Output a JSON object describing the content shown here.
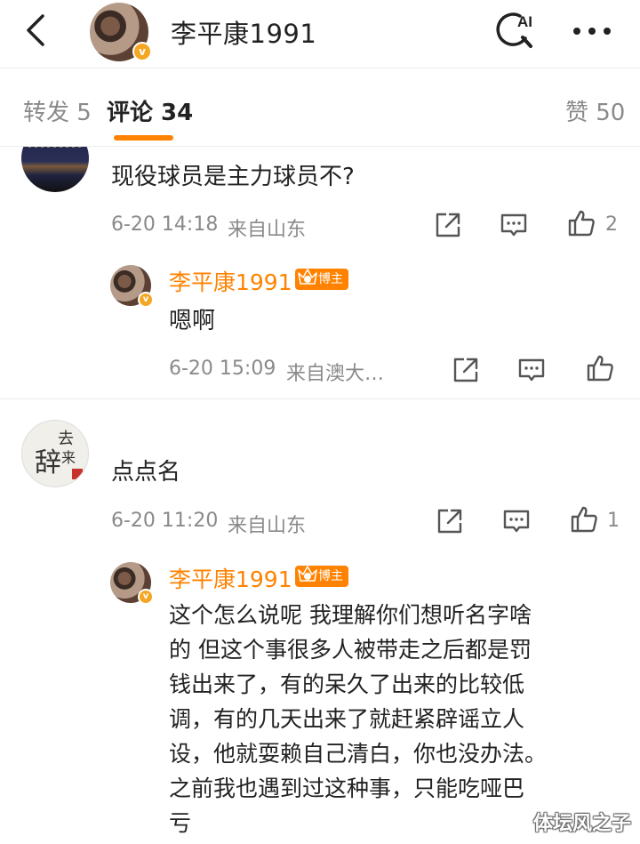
{
  "header": {
    "user_name": "李平康1991",
    "verified_badge": "v",
    "ai_label": "AI",
    "icons": [
      "back-arrow-icon",
      "ai-search-icon",
      "more-dots-icon"
    ]
  },
  "tabs": {
    "repost": "转发 5",
    "comments": "评论 34",
    "likes": "赞 50",
    "accent_color": "#ff8200"
  },
  "comments": [
    {
      "text": "现役球员是主力球员不?",
      "time": "6-20 14:18",
      "location": "来自山东",
      "like_count": "2",
      "reply": {
        "name": "李平康1991",
        "badge": "博主",
        "text": "嗯啊",
        "time": "6-20 15:09",
        "location": "来自澳大…"
      }
    },
    {
      "avatar_text": [
        "去",
        "来",
        "辞"
      ],
      "text": "点点名",
      "time": "6-20 11:20",
      "location": "来自山东",
      "like_count": "1",
      "reply": {
        "name": "李平康1991",
        "badge": "博主",
        "lines": [
          "这个怎么说呢 我理解你们想听名字啥",
          "的 但这个事很多人被带走之后都是罚",
          "钱出来了，有的呆久了出来的比较低",
          "调，有的几天出来了就赶紧辟谣立人",
          "设，他就耍赖自己清白，你也没办法。",
          "之前我也遇到过这种事，只能吃哑巴",
          "亏"
        ]
      }
    }
  ],
  "watermark": "体坛风之子"
}
